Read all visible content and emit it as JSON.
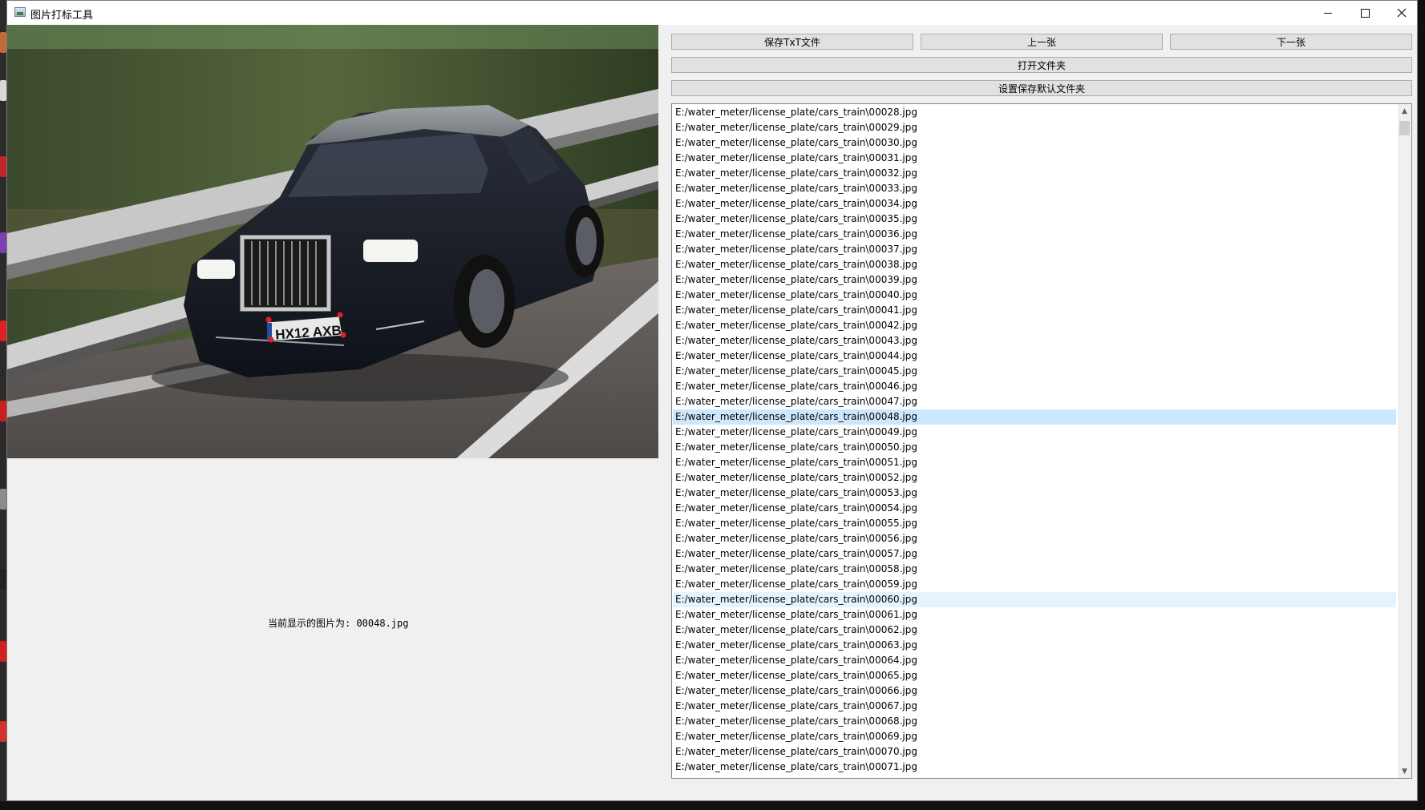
{
  "window": {
    "title": "图片打标工具"
  },
  "toolbar": {
    "save_txt": "保存TxT文件",
    "prev": "上一张",
    "next": "下一张",
    "open_folder": "打开文件夹",
    "set_default_folder": "设置保存默认文件夹"
  },
  "viewer": {
    "plate_text": "HX12 AXB",
    "current_label": "当前显示的图片为: 00048.jpg"
  },
  "file_list": {
    "selected_index": 20,
    "hover_index": 32,
    "items": [
      "E:/water_meter/license_plate/cars_train\\00028.jpg",
      "E:/water_meter/license_plate/cars_train\\00029.jpg",
      "E:/water_meter/license_plate/cars_train\\00030.jpg",
      "E:/water_meter/license_plate/cars_train\\00031.jpg",
      "E:/water_meter/license_plate/cars_train\\00032.jpg",
      "E:/water_meter/license_plate/cars_train\\00033.jpg",
      "E:/water_meter/license_plate/cars_train\\00034.jpg",
      "E:/water_meter/license_plate/cars_train\\00035.jpg",
      "E:/water_meter/license_plate/cars_train\\00036.jpg",
      "E:/water_meter/license_plate/cars_train\\00037.jpg",
      "E:/water_meter/license_plate/cars_train\\00038.jpg",
      "E:/water_meter/license_plate/cars_train\\00039.jpg",
      "E:/water_meter/license_plate/cars_train\\00040.jpg",
      "E:/water_meter/license_plate/cars_train\\00041.jpg",
      "E:/water_meter/license_plate/cars_train\\00042.jpg",
      "E:/water_meter/license_plate/cars_train\\00043.jpg",
      "E:/water_meter/license_plate/cars_train\\00044.jpg",
      "E:/water_meter/license_plate/cars_train\\00045.jpg",
      "E:/water_meter/license_plate/cars_train\\00046.jpg",
      "E:/water_meter/license_plate/cars_train\\00047.jpg",
      "E:/water_meter/license_plate/cars_train\\00048.jpg",
      "E:/water_meter/license_plate/cars_train\\00049.jpg",
      "E:/water_meter/license_plate/cars_train\\00050.jpg",
      "E:/water_meter/license_plate/cars_train\\00051.jpg",
      "E:/water_meter/license_plate/cars_train\\00052.jpg",
      "E:/water_meter/license_plate/cars_train\\00053.jpg",
      "E:/water_meter/license_plate/cars_train\\00054.jpg",
      "E:/water_meter/license_plate/cars_train\\00055.jpg",
      "E:/water_meter/license_plate/cars_train\\00056.jpg",
      "E:/water_meter/license_plate/cars_train\\00057.jpg",
      "E:/water_meter/license_plate/cars_train\\00058.jpg",
      "E:/water_meter/license_plate/cars_train\\00059.jpg",
      "E:/water_meter/license_plate/cars_train\\00060.jpg",
      "E:/water_meter/license_plate/cars_train\\00061.jpg",
      "E:/water_meter/license_plate/cars_train\\00062.jpg",
      "E:/water_meter/license_plate/cars_train\\00063.jpg",
      "E:/water_meter/license_plate/cars_train\\00064.jpg",
      "E:/water_meter/license_plate/cars_train\\00065.jpg",
      "E:/water_meter/license_plate/cars_train\\00066.jpg",
      "E:/water_meter/license_plate/cars_train\\00067.jpg",
      "E:/water_meter/license_plate/cars_train\\00068.jpg",
      "E:/water_meter/license_plate/cars_train\\00069.jpg",
      "E:/water_meter/license_plate/cars_train\\00070.jpg",
      "E:/water_meter/license_plate/cars_train\\00071.jpg"
    ]
  },
  "icons": {
    "minimize": "minimize-icon",
    "maximize": "maximize-icon",
    "close": "close-icon",
    "scroll_up": "scroll-up-icon",
    "scroll_down": "scroll-down-icon"
  },
  "colors": {
    "selection": "#cce8ff",
    "hover": "#e5f3ff",
    "annotation_point": "#e02020"
  }
}
